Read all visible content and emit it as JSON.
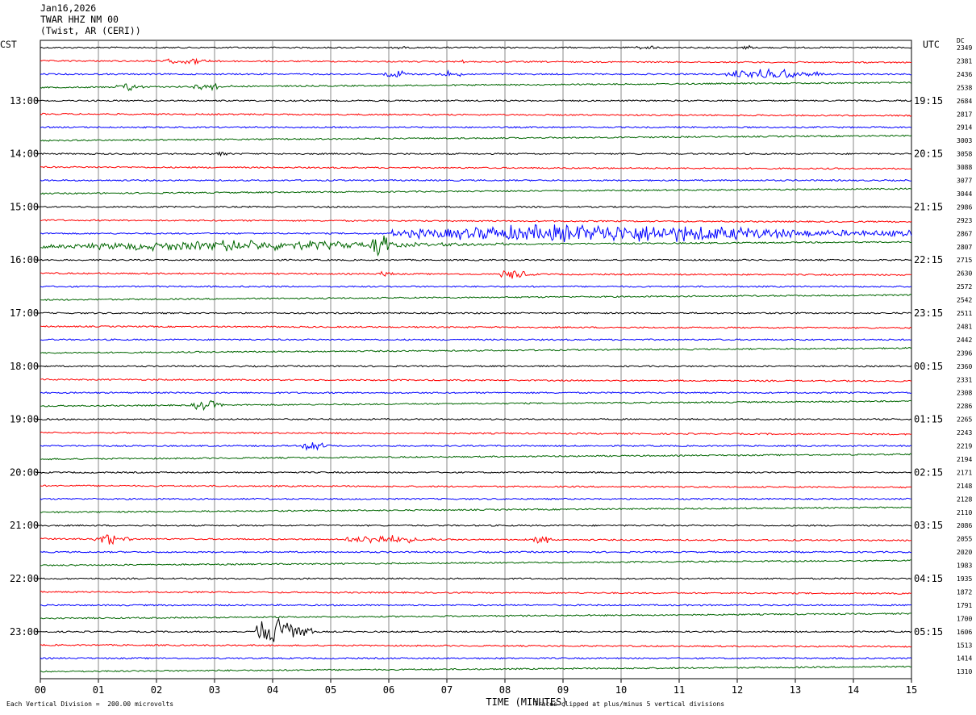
{
  "header": {
    "date": "Jan16,2026",
    "station": "TWAR HHZ NM 00",
    "location": "(Twist, AR (CERI))"
  },
  "left_axis_label": "CST",
  "right_axis_label": "UTC",
  "dc_label": "DC",
  "footer": {
    "scale_note": "Each Vertical Division =  200.00 microvolts",
    "clip_note": "Traces clipped at plus/minus 5 vertical divisions"
  },
  "chart_data": {
    "type": "line",
    "title": "TWAR HHZ NM 00 (Twist, AR (CERI))",
    "xlabel": "TIME (MINUTES)",
    "xlim": [
      0,
      15
    ],
    "x_ticks": [
      "00",
      "01",
      "02",
      "03",
      "04",
      "05",
      "06",
      "07",
      "08",
      "09",
      "10",
      "11",
      "12",
      "13",
      "14",
      "15"
    ],
    "grid": true,
    "trace_colors": [
      "#000000",
      "#ff0000",
      "#0000ff",
      "#006600"
    ],
    "cst_hour_labels": [
      "13:00",
      "14:00",
      "15:00",
      "16:00",
      "17:00",
      "18:00",
      "19:00",
      "20:00",
      "21:00",
      "22:00",
      "23:00"
    ],
    "utc_hour_labels": [
      "19:15",
      "20:15",
      "21:15",
      "22:15",
      "23:15",
      "00:15",
      "01:15",
      "02:15",
      "03:15",
      "04:15",
      "05:15"
    ],
    "dc_offsets": [
      2349,
      2381,
      2436,
      2538,
      2684,
      2817,
      2914,
      3003,
      3058,
      3088,
      3077,
      3044,
      2986,
      2923,
      2867,
      2807,
      2715,
      2630,
      2572,
      2542,
      2511,
      2481,
      2442,
      2396,
      2360,
      2331,
      2308,
      2286,
      2265,
      2243,
      2219,
      2194,
      2171,
      2148,
      2128,
      2110,
      2086,
      2055,
      2020,
      1983,
      1935,
      1872,
      1791,
      1700,
      1606,
      1513,
      1414,
      1310
    ],
    "events": [
      {
        "trace": 0,
        "start": 6.1,
        "end": 6.4,
        "amp": 3
      },
      {
        "trace": 0,
        "start": 10.2,
        "end": 10.8,
        "amp": 3
      },
      {
        "trace": 0,
        "start": 12.1,
        "end": 12.3,
        "amp": 5
      },
      {
        "trace": 1,
        "start": 2.0,
        "end": 3.2,
        "amp": 4
      },
      {
        "trace": 1,
        "start": 7.2,
        "end": 7.4,
        "amp": 3
      },
      {
        "trace": 2,
        "start": 5.9,
        "end": 6.5,
        "amp": 6
      },
      {
        "trace": 2,
        "start": 6.8,
        "end": 7.4,
        "amp": 5
      },
      {
        "trace": 2,
        "start": 11.8,
        "end": 13.5,
        "amp": 8
      },
      {
        "trace": 3,
        "start": 1.3,
        "end": 1.8,
        "amp": 6
      },
      {
        "trace": 3,
        "start": 2.6,
        "end": 3.3,
        "amp": 5
      },
      {
        "trace": 8,
        "start": 2.9,
        "end": 3.4,
        "amp": 3
      },
      {
        "trace": 14,
        "start": 6.0,
        "end": 15.0,
        "amp": 13
      },
      {
        "trace": 15,
        "start": 0.0,
        "end": 8.0,
        "amp": 7
      },
      {
        "trace": 15,
        "start": 3.1,
        "end": 3.5,
        "amp": 12
      },
      {
        "trace": 15,
        "start": 5.7,
        "end": 6.1,
        "amp": 18
      },
      {
        "trace": 17,
        "start": 5.8,
        "end": 6.1,
        "amp": 6
      },
      {
        "trace": 17,
        "start": 7.9,
        "end": 8.5,
        "amp": 8
      },
      {
        "trace": 27,
        "start": 2.6,
        "end": 3.2,
        "amp": 8
      },
      {
        "trace": 30,
        "start": 4.5,
        "end": 5.0,
        "amp": 8
      },
      {
        "trace": 37,
        "start": 0.9,
        "end": 1.6,
        "amp": 8
      },
      {
        "trace": 37,
        "start": 5.2,
        "end": 6.8,
        "amp": 7
      },
      {
        "trace": 37,
        "start": 8.5,
        "end": 8.8,
        "amp": 12
      },
      {
        "trace": 44,
        "start": 3.7,
        "end": 4.7,
        "amp": 25
      }
    ]
  }
}
